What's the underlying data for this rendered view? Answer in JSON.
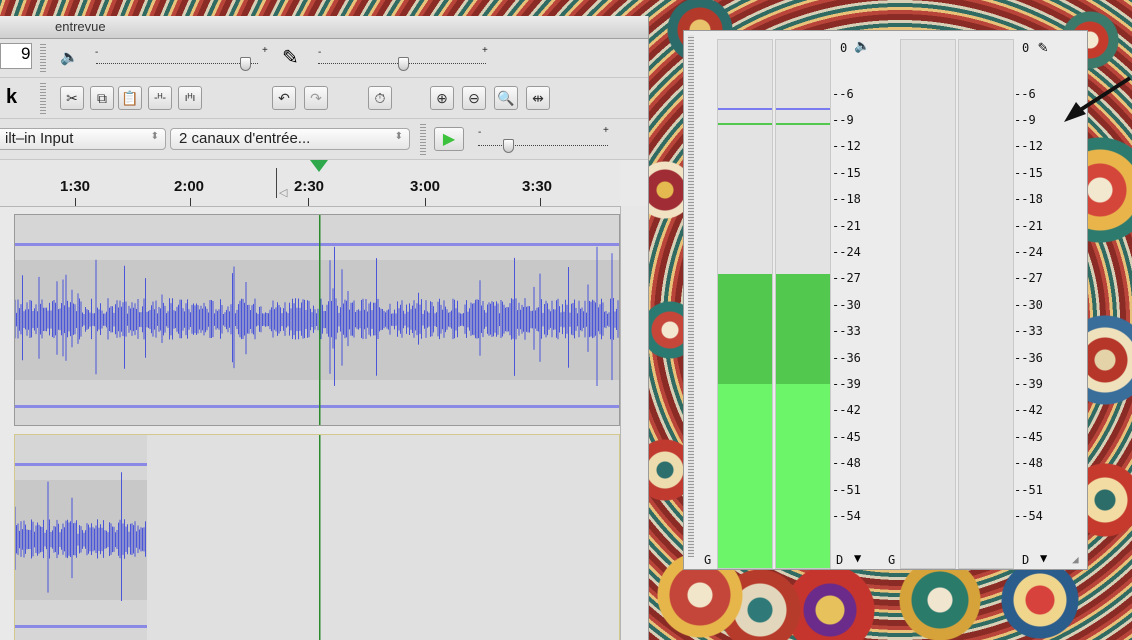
{
  "window": {
    "title": "entrevue"
  },
  "toolbar": {
    "clipped_left_text": "9",
    "clipped_tool_letter": "k",
    "output_slider_plus": "+",
    "output_slider_minus": "-",
    "input_slider_plus": "+",
    "input_slider_minus": "-",
    "playback_speed_plus": "+",
    "playback_speed_minus": "-",
    "edit_icons": [
      "cut-icon",
      "copy-icon",
      "paste-icon",
      "trim-icon",
      "silence-icon",
      "undo-icon",
      "redo-icon",
      "sync-lock-icon",
      "zoom-in-icon",
      "zoom-out-icon",
      "fit-selection-icon",
      "fit-project-icon"
    ]
  },
  "device": {
    "input_device": "ilt–in Input",
    "channels": "2 canaux d'entrée..."
  },
  "ruler": {
    "labels": [
      "1:30",
      "2:00",
      "2:30",
      "3:00",
      "3:30"
    ]
  },
  "meter": {
    "left_label_g": "G",
    "left_label_d": "D",
    "right_label_g": "G",
    "right_label_d": "D",
    "zero": "0",
    "scale": [
      "--6",
      "--9",
      "--12",
      "--15",
      "--18",
      "--21",
      "--24",
      "--27",
      "--30",
      "--33",
      "--36",
      "--39",
      "--42",
      "--45",
      "--48",
      "--51",
      "--54"
    ],
    "playback_peak_db": -9,
    "playback_max_db": -7,
    "playback_rms_db": -27,
    "playback_avg_db": -39,
    "colors": {
      "peak": "#52c94e",
      "rms": "#6df56a",
      "max_line": "#7b7bf0"
    }
  },
  "colors": {
    "waveform": "#4a55d8",
    "cursor": "#2a8a2a"
  }
}
